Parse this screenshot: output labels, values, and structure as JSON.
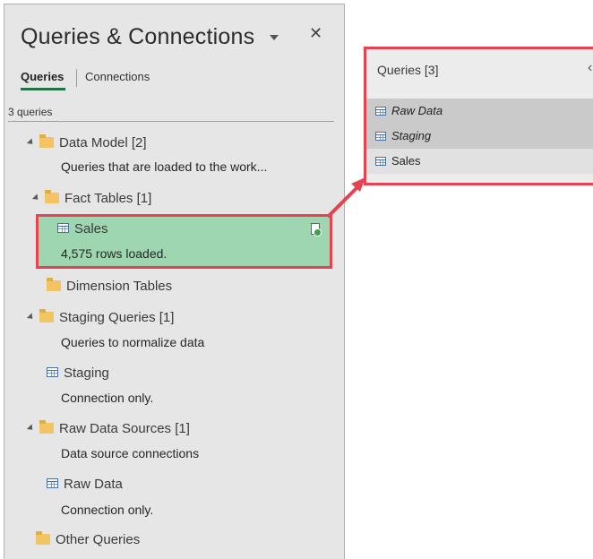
{
  "pane": {
    "title": "Queries & Connections",
    "tabs": [
      "Queries",
      "Connections"
    ],
    "query_count": "3 queries"
  },
  "tree": {
    "data_model": {
      "label": "Data Model [2]",
      "desc": "Queries that are loaded to the work..."
    },
    "fact_tables": {
      "label": "Fact Tables [1]"
    },
    "sales": {
      "label": "Sales",
      "status": "4,575 rows loaded."
    },
    "dimension_tables": {
      "label": "Dimension Tables"
    },
    "staging_queries": {
      "label": "Staging Queries [1]",
      "desc": "Queries to normalize data"
    },
    "staging": {
      "label": "Staging",
      "status": "Connection only."
    },
    "raw_sources": {
      "label": "Raw Data Sources [1]",
      "desc": "Data source connections"
    },
    "raw_data": {
      "label": "Raw Data",
      "status": "Connection only."
    },
    "other": {
      "label": "Other Queries"
    }
  },
  "popup": {
    "title": "Queries [3]",
    "items": [
      "Raw Data",
      "Staging",
      "Sales"
    ]
  },
  "colors": {
    "highlight_green": "#9fd6b2",
    "callout_red": "#e8414f",
    "folder_yellow": "#f2c464",
    "tab_accent": "#217346"
  }
}
